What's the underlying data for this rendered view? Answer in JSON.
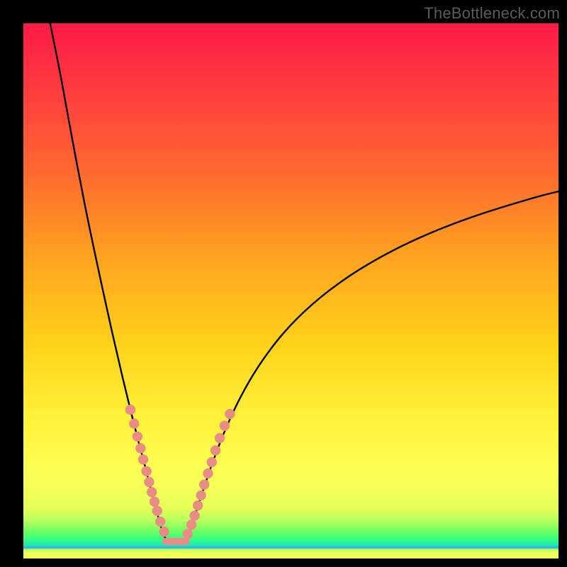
{
  "watermark": "TheBottleneck.com",
  "chart_data": {
    "type": "line",
    "title": "",
    "xlabel": "",
    "ylabel": "",
    "xlim": [
      0,
      100
    ],
    "ylim": [
      0,
      100
    ],
    "curves": {
      "left": {
        "note": "steep descending curve from top-left to trough",
        "points": [
          {
            "x": 5.0,
            "y": 100.0
          },
          {
            "x": 7.0,
            "y": 90.0
          },
          {
            "x": 9.2,
            "y": 78.0
          },
          {
            "x": 11.5,
            "y": 66.0
          },
          {
            "x": 13.8,
            "y": 55.0
          },
          {
            "x": 16.2,
            "y": 44.0
          },
          {
            "x": 18.5,
            "y": 34.0
          },
          {
            "x": 20.2,
            "y": 27.0
          },
          {
            "x": 21.6,
            "y": 21.5
          },
          {
            "x": 22.8,
            "y": 17.0
          },
          {
            "x": 23.8,
            "y": 13.0
          },
          {
            "x": 24.6,
            "y": 10.0
          },
          {
            "x": 25.4,
            "y": 7.0
          },
          {
            "x": 26.2,
            "y": 4.5
          },
          {
            "x": 27.0,
            "y": 3.0
          }
        ]
      },
      "right": {
        "note": "rising curve from trough up toward upper-right, concave",
        "points": [
          {
            "x": 30.0,
            "y": 3.0
          },
          {
            "x": 31.0,
            "y": 5.0
          },
          {
            "x": 32.2,
            "y": 8.5
          },
          {
            "x": 33.5,
            "y": 12.5
          },
          {
            "x": 35.2,
            "y": 17.5
          },
          {
            "x": 37.5,
            "y": 23.5
          },
          {
            "x": 40.5,
            "y": 30.0
          },
          {
            "x": 44.0,
            "y": 36.0
          },
          {
            "x": 48.5,
            "y": 42.0
          },
          {
            "x": 54.0,
            "y": 47.5
          },
          {
            "x": 60.5,
            "y": 52.5
          },
          {
            "x": 68.0,
            "y": 57.0
          },
          {
            "x": 76.0,
            "y": 60.8
          },
          {
            "x": 85.0,
            "y": 64.2
          },
          {
            "x": 95.0,
            "y": 67.3
          },
          {
            "x": 100.0,
            "y": 68.6
          }
        ]
      }
    },
    "markers": {
      "note": "salmon circular markers clustered near the trough on both branches, plus a short bridge segment at the bottom",
      "left_branch": [
        {
          "x": 20.0,
          "y": 27.8
        },
        {
          "x": 20.7,
          "y": 25.2
        },
        {
          "x": 21.3,
          "y": 22.8
        },
        {
          "x": 21.9,
          "y": 20.6
        },
        {
          "x": 22.4,
          "y": 18.5
        },
        {
          "x": 23.0,
          "y": 16.3
        },
        {
          "x": 23.5,
          "y": 14.3
        },
        {
          "x": 24.0,
          "y": 12.4
        },
        {
          "x": 24.5,
          "y": 10.6
        },
        {
          "x": 25.0,
          "y": 8.9
        },
        {
          "x": 25.6,
          "y": 6.9
        },
        {
          "x": 26.3,
          "y": 5.0
        }
      ],
      "right_branch": [
        {
          "x": 30.7,
          "y": 4.6
        },
        {
          "x": 31.4,
          "y": 6.3
        },
        {
          "x": 32.0,
          "y": 8.0
        },
        {
          "x": 32.6,
          "y": 9.9
        },
        {
          "x": 33.2,
          "y": 11.8
        },
        {
          "x": 33.8,
          "y": 13.8
        },
        {
          "x": 34.5,
          "y": 15.9
        },
        {
          "x": 35.2,
          "y": 18.0
        },
        {
          "x": 35.9,
          "y": 20.2
        },
        {
          "x": 36.7,
          "y": 22.5
        },
        {
          "x": 37.6,
          "y": 24.8
        },
        {
          "x": 38.6,
          "y": 27.0
        }
      ],
      "bridge": {
        "x1": 26.6,
        "x2": 30.4,
        "y": 3.2
      }
    },
    "marker_radius_px": 7.0
  }
}
